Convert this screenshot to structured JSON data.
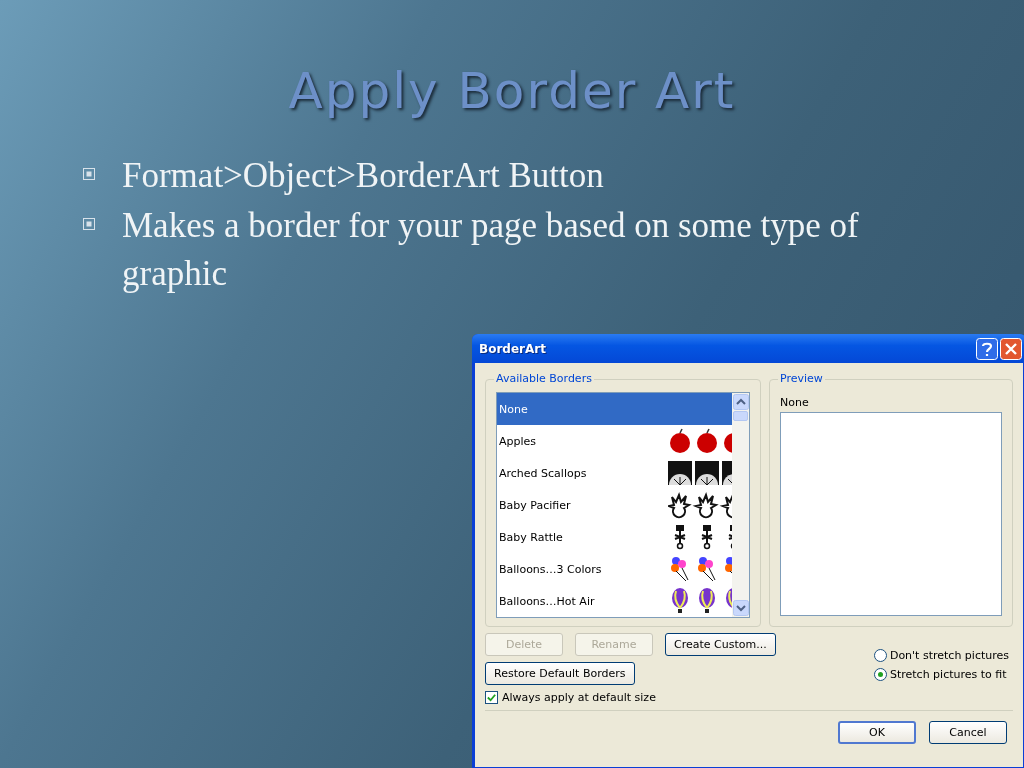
{
  "slide": {
    "title": "Apply Border Art",
    "bullets": [
      "Format>Object>BorderArt Button",
      "Makes a border for your page based on some type of graphic"
    ]
  },
  "dialog": {
    "title": "BorderArt",
    "available_group": {
      "label": "Available Borders",
      "items": [
        {
          "label": "None",
          "selected": true,
          "kind": "none"
        },
        {
          "label": "Apples",
          "selected": false,
          "kind": "apples"
        },
        {
          "label": "Arched Scallops",
          "selected": false,
          "kind": "scallops"
        },
        {
          "label": "Baby Pacifier",
          "selected": false,
          "kind": "pacifier"
        },
        {
          "label": "Baby Rattle",
          "selected": false,
          "kind": "rattle"
        },
        {
          "label": "Balloons…3 Colors",
          "selected": false,
          "kind": "balloons"
        },
        {
          "label": "Balloons…Hot Air",
          "selected": false,
          "kind": "hotair"
        }
      ]
    },
    "preview_group": {
      "label": "Preview",
      "caption": "None"
    },
    "buttons": [
      {
        "label": "Delete",
        "disabled": true
      },
      {
        "label": "Rename",
        "disabled": true
      },
      {
        "label": "Create Custom...",
        "disabled": false
      }
    ],
    "restore_button": "Restore Default Borders",
    "always_apply": {
      "label": "Always apply at default size",
      "checked": true
    },
    "stretch_options": [
      {
        "label": "Don't stretch pictures",
        "selected": false
      },
      {
        "label": "Stretch pictures to fit",
        "selected": true
      }
    ],
    "ok_button": "OK",
    "cancel_button": "Cancel"
  }
}
